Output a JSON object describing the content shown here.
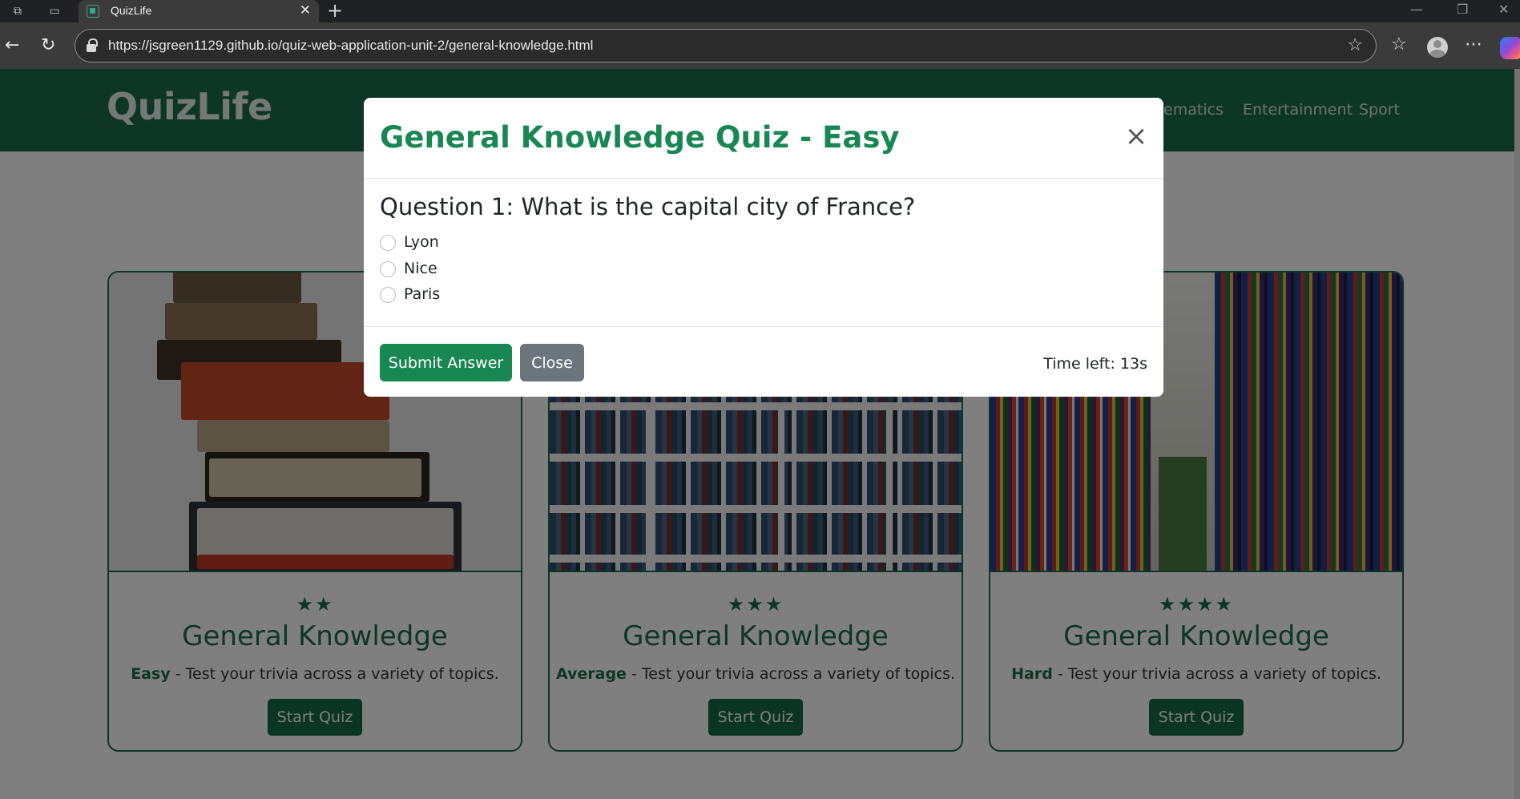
{
  "browser": {
    "tab_title": "QuizLife",
    "tab_close": "✕",
    "new_tab": "+",
    "url": "https://jsgreen1129.github.io/quiz-web-application-unit-2/general-knowledge.html",
    "icons": [
      "workspaces-icon",
      "tab-actions-icon",
      "back-icon",
      "refresh-icon",
      "lock-icon",
      "favorite-star-icon",
      "favorites-list-icon",
      "profile-avatar-icon",
      "more-menu-icon",
      "copilot-icon"
    ]
  },
  "site": {
    "brand": "QuizLife",
    "nav": [
      {
        "label": "hematics"
      },
      {
        "label": "Entertainment"
      },
      {
        "label": "Sport"
      }
    ],
    "colors": {
      "primary": "#1b6d4c",
      "button": "#146b49",
      "success": "#198754",
      "secondary": "#6c757d"
    }
  },
  "cards": [
    {
      "stars": "★★",
      "title": "General Knowledge",
      "level": "Easy",
      "description": " - Test your trivia across a variety of topics.",
      "button": "Start Quiz",
      "image": "stacked-books"
    },
    {
      "stars": "★★★",
      "title": "General Knowledge",
      "level": "Average",
      "description": " - Test your trivia across a variety of topics.",
      "button": "Start Quiz",
      "image": "bookshelf"
    },
    {
      "stars": "★★★★",
      "title": "General Knowledge",
      "level": "Hard",
      "description": " - Test your trivia across a variety of topics.",
      "button": "Start Quiz",
      "image": "library-aisle"
    }
  ],
  "modal": {
    "title": "General Knowledge Quiz - Easy",
    "close_icon": "×",
    "question": "Question 1: What is the capital city of France?",
    "options": [
      {
        "label": "Lyon",
        "selected": false
      },
      {
        "label": "Nice",
        "selected": false
      },
      {
        "label": "Paris",
        "selected": false
      }
    ],
    "submit_label": "Submit Answer",
    "close_label": "Close",
    "timer": "Time left: 13s"
  }
}
